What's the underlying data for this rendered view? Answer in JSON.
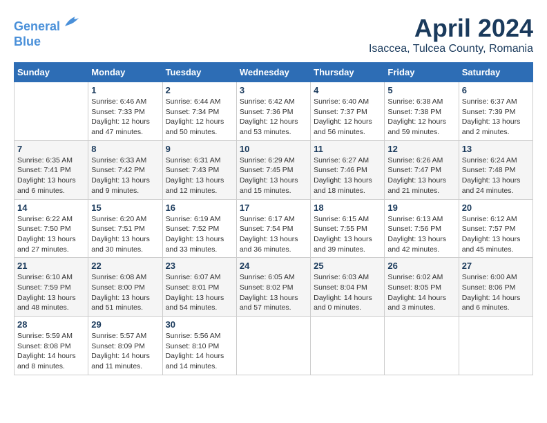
{
  "header": {
    "logo_line1": "General",
    "logo_line2": "Blue",
    "title": "April 2024",
    "location": "Isaccea, Tulcea County, Romania"
  },
  "calendar": {
    "days_of_week": [
      "Sunday",
      "Monday",
      "Tuesday",
      "Wednesday",
      "Thursday",
      "Friday",
      "Saturday"
    ],
    "weeks": [
      [
        {
          "day": "",
          "info": ""
        },
        {
          "day": "1",
          "info": "Sunrise: 6:46 AM\nSunset: 7:33 PM\nDaylight: 12 hours\nand 47 minutes."
        },
        {
          "day": "2",
          "info": "Sunrise: 6:44 AM\nSunset: 7:34 PM\nDaylight: 12 hours\nand 50 minutes."
        },
        {
          "day": "3",
          "info": "Sunrise: 6:42 AM\nSunset: 7:36 PM\nDaylight: 12 hours\nand 53 minutes."
        },
        {
          "day": "4",
          "info": "Sunrise: 6:40 AM\nSunset: 7:37 PM\nDaylight: 12 hours\nand 56 minutes."
        },
        {
          "day": "5",
          "info": "Sunrise: 6:38 AM\nSunset: 7:38 PM\nDaylight: 12 hours\nand 59 minutes."
        },
        {
          "day": "6",
          "info": "Sunrise: 6:37 AM\nSunset: 7:39 PM\nDaylight: 13 hours\nand 2 minutes."
        }
      ],
      [
        {
          "day": "7",
          "info": "Sunrise: 6:35 AM\nSunset: 7:41 PM\nDaylight: 13 hours\nand 6 minutes."
        },
        {
          "day": "8",
          "info": "Sunrise: 6:33 AM\nSunset: 7:42 PM\nDaylight: 13 hours\nand 9 minutes."
        },
        {
          "day": "9",
          "info": "Sunrise: 6:31 AM\nSunset: 7:43 PM\nDaylight: 13 hours\nand 12 minutes."
        },
        {
          "day": "10",
          "info": "Sunrise: 6:29 AM\nSunset: 7:45 PM\nDaylight: 13 hours\nand 15 minutes."
        },
        {
          "day": "11",
          "info": "Sunrise: 6:27 AM\nSunset: 7:46 PM\nDaylight: 13 hours\nand 18 minutes."
        },
        {
          "day": "12",
          "info": "Sunrise: 6:26 AM\nSunset: 7:47 PM\nDaylight: 13 hours\nand 21 minutes."
        },
        {
          "day": "13",
          "info": "Sunrise: 6:24 AM\nSunset: 7:48 PM\nDaylight: 13 hours\nand 24 minutes."
        }
      ],
      [
        {
          "day": "14",
          "info": "Sunrise: 6:22 AM\nSunset: 7:50 PM\nDaylight: 13 hours\nand 27 minutes."
        },
        {
          "day": "15",
          "info": "Sunrise: 6:20 AM\nSunset: 7:51 PM\nDaylight: 13 hours\nand 30 minutes."
        },
        {
          "day": "16",
          "info": "Sunrise: 6:19 AM\nSunset: 7:52 PM\nDaylight: 13 hours\nand 33 minutes."
        },
        {
          "day": "17",
          "info": "Sunrise: 6:17 AM\nSunset: 7:54 PM\nDaylight: 13 hours\nand 36 minutes."
        },
        {
          "day": "18",
          "info": "Sunrise: 6:15 AM\nSunset: 7:55 PM\nDaylight: 13 hours\nand 39 minutes."
        },
        {
          "day": "19",
          "info": "Sunrise: 6:13 AM\nSunset: 7:56 PM\nDaylight: 13 hours\nand 42 minutes."
        },
        {
          "day": "20",
          "info": "Sunrise: 6:12 AM\nSunset: 7:57 PM\nDaylight: 13 hours\nand 45 minutes."
        }
      ],
      [
        {
          "day": "21",
          "info": "Sunrise: 6:10 AM\nSunset: 7:59 PM\nDaylight: 13 hours\nand 48 minutes."
        },
        {
          "day": "22",
          "info": "Sunrise: 6:08 AM\nSunset: 8:00 PM\nDaylight: 13 hours\nand 51 minutes."
        },
        {
          "day": "23",
          "info": "Sunrise: 6:07 AM\nSunset: 8:01 PM\nDaylight: 13 hours\nand 54 minutes."
        },
        {
          "day": "24",
          "info": "Sunrise: 6:05 AM\nSunset: 8:02 PM\nDaylight: 13 hours\nand 57 minutes."
        },
        {
          "day": "25",
          "info": "Sunrise: 6:03 AM\nSunset: 8:04 PM\nDaylight: 14 hours\nand 0 minutes."
        },
        {
          "day": "26",
          "info": "Sunrise: 6:02 AM\nSunset: 8:05 PM\nDaylight: 14 hours\nand 3 minutes."
        },
        {
          "day": "27",
          "info": "Sunrise: 6:00 AM\nSunset: 8:06 PM\nDaylight: 14 hours\nand 6 minutes."
        }
      ],
      [
        {
          "day": "28",
          "info": "Sunrise: 5:59 AM\nSunset: 8:08 PM\nDaylight: 14 hours\nand 8 minutes."
        },
        {
          "day": "29",
          "info": "Sunrise: 5:57 AM\nSunset: 8:09 PM\nDaylight: 14 hours\nand 11 minutes."
        },
        {
          "day": "30",
          "info": "Sunrise: 5:56 AM\nSunset: 8:10 PM\nDaylight: 14 hours\nand 14 minutes."
        },
        {
          "day": "",
          "info": ""
        },
        {
          "day": "",
          "info": ""
        },
        {
          "day": "",
          "info": ""
        },
        {
          "day": "",
          "info": ""
        }
      ]
    ]
  }
}
